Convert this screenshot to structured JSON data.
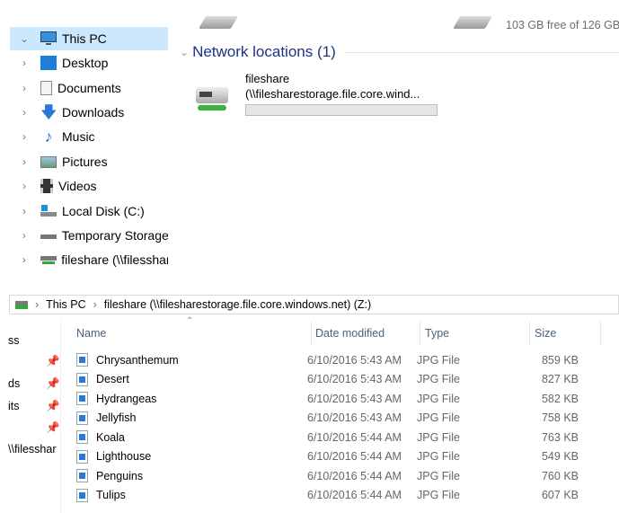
{
  "top": {
    "drive_free_text": "103 GB free of 126 GB",
    "section_title": "Network locations (1)",
    "network_item": {
      "name": "fileshare",
      "path": "(\\\\filesharestorage.file.core.wind...",
      "usage_fraction": 0
    }
  },
  "nav": {
    "items": [
      {
        "label": "This PC",
        "icon": "computer-icon",
        "selected": true,
        "expanded": true
      },
      {
        "label": "Desktop",
        "icon": "desktop-icon"
      },
      {
        "label": "Documents",
        "icon": "documents-icon"
      },
      {
        "label": "Downloads",
        "icon": "downloads-icon"
      },
      {
        "label": "Music",
        "icon": "music-icon"
      },
      {
        "label": "Pictures",
        "icon": "pictures-icon"
      },
      {
        "label": "Videos",
        "icon": "videos-icon"
      },
      {
        "label": "Local Disk (C:)",
        "icon": "local-disk-icon"
      },
      {
        "label": "Temporary Storage",
        "icon": "drive-icon"
      },
      {
        "label": "fileshare (\\\\filesshar",
        "icon": "network-drive-icon"
      }
    ]
  },
  "breadcrumb": [
    "This PC",
    "fileshare (\\\\filesharestorage.file.core.windows.net) (Z:)"
  ],
  "quick_access_partial": [
    "ss",
    "ds",
    "its",
    "\\\\filesshar"
  ],
  "columns": {
    "name": "Name",
    "date": "Date modified",
    "type": "Type",
    "size": "Size"
  },
  "files": [
    {
      "name": "Chrysanthemum",
      "date": "6/10/2016 5:43 AM",
      "type": "JPG File",
      "size": "859 KB"
    },
    {
      "name": "Desert",
      "date": "6/10/2016 5:43 AM",
      "type": "JPG File",
      "size": "827 KB"
    },
    {
      "name": "Hydrangeas",
      "date": "6/10/2016 5:43 AM",
      "type": "JPG File",
      "size": "582 KB"
    },
    {
      "name": "Jellyfish",
      "date": "6/10/2016 5:43 AM",
      "type": "JPG File",
      "size": "758 KB"
    },
    {
      "name": "Koala",
      "date": "6/10/2016 5:44 AM",
      "type": "JPG File",
      "size": "763 KB"
    },
    {
      "name": "Lighthouse",
      "date": "6/10/2016 5:44 AM",
      "type": "JPG File",
      "size": "549 KB"
    },
    {
      "name": "Penguins",
      "date": "6/10/2016 5:44 AM",
      "type": "JPG File",
      "size": "760 KB"
    },
    {
      "name": "Tulips",
      "date": "6/10/2016 5:44 AM",
      "type": "JPG File",
      "size": "607 KB"
    }
  ]
}
